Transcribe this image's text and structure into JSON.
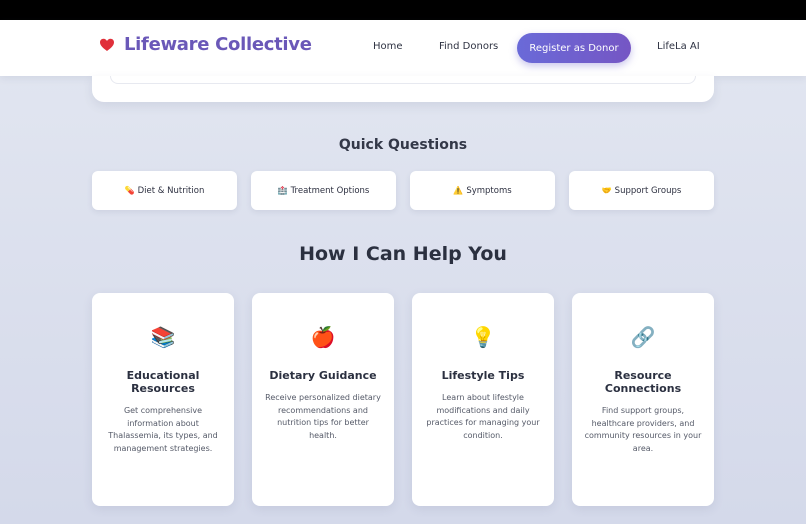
{
  "brand": {
    "name": "Lifeware Collective",
    "icon": "heart-icon",
    "color": "#6a58b8"
  },
  "nav": {
    "home": "Home",
    "find_donors": "Find Donors",
    "register": "Register as Donor",
    "ai": "LifeLa AI"
  },
  "quick_questions": {
    "title": "Quick Questions",
    "items": [
      {
        "icon": "💊",
        "label": "Diet & Nutrition"
      },
      {
        "icon": "🏥",
        "label": "Treatment Options"
      },
      {
        "icon": "⚠️",
        "label": "Symptoms"
      },
      {
        "icon": "🤝",
        "label": "Support Groups"
      }
    ]
  },
  "help": {
    "title": "How I Can Help You",
    "cards": [
      {
        "icon": "📚",
        "title": "Educational Resources",
        "desc": "Get comprehensive information about Thalassemia, its types, and management strategies."
      },
      {
        "icon": "🍎",
        "title": "Dietary Guidance",
        "desc": "Receive personalized dietary recommendations and nutrition tips for better health."
      },
      {
        "icon": "💡",
        "title": "Lifestyle Tips",
        "desc": "Learn about lifestyle modifications and daily practices for managing your condition."
      },
      {
        "icon": "🔗",
        "title": "Resource Connections",
        "desc": "Find support groups, healthcare providers, and community resources in your area."
      }
    ]
  }
}
